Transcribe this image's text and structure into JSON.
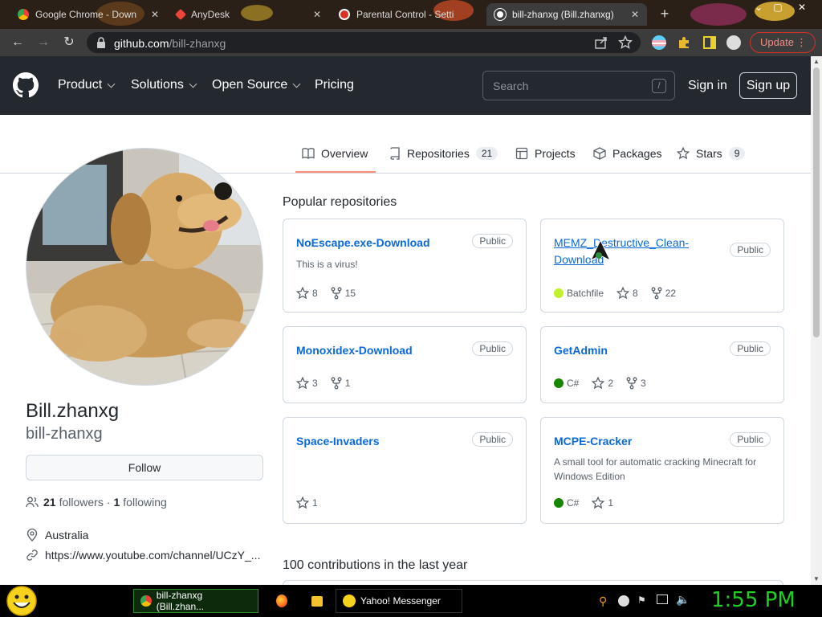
{
  "browser": {
    "tabs": [
      {
        "title": "Google Chrome - Down",
        "active": false
      },
      {
        "title": "AnyDesk",
        "active": false
      },
      {
        "title": "Parental Control - Setti",
        "active": false
      },
      {
        "title": "bill-zhanxg (Bill.zhanxg)",
        "active": true
      }
    ],
    "url_host": "github.com",
    "url_path": "/bill-zhanxg",
    "update_label": "Update"
  },
  "header": {
    "nav": [
      "Product",
      "Solutions",
      "Open Source",
      "Pricing"
    ],
    "search_placeholder": "Search",
    "search_key": "/",
    "signin": "Sign in",
    "signup": "Sign up"
  },
  "profile_tabs": [
    {
      "label": "Overview",
      "count": "",
      "active": true,
      "icon": "book-icon"
    },
    {
      "label": "Repositories",
      "count": "21",
      "active": false,
      "icon": "repo-icon"
    },
    {
      "label": "Projects",
      "count": "",
      "active": false,
      "icon": "table-icon"
    },
    {
      "label": "Packages",
      "count": "",
      "active": false,
      "icon": "package-icon"
    },
    {
      "label": "Stars",
      "count": "9",
      "active": false,
      "icon": "star-icon"
    }
  ],
  "profile": {
    "fullname": "Bill.zhanxg",
    "login": "bill-zhanxg",
    "follow_label": "Follow",
    "followers_count": "21",
    "followers_label": "followers",
    "following_count": "1",
    "following_label": "following",
    "separator": "·",
    "location": "Australia",
    "website": "https://www.youtube.com/channel/UCzY_..."
  },
  "popular": {
    "heading": "Popular repositories",
    "repos": [
      {
        "name": "NoEscape.exe-Download",
        "visibility": "Public",
        "description": "This is a virus!",
        "language": "",
        "lang_color": "",
        "stars": "8",
        "forks": "15"
      },
      {
        "name": "MEMZ_Destructive_Clean-Download",
        "visibility": "Public",
        "description": "",
        "language": "Batchfile",
        "lang_color": "#C1F12E",
        "stars": "8",
        "forks": "22"
      },
      {
        "name": "Monoxidex-Download",
        "visibility": "Public",
        "description": "",
        "language": "",
        "lang_color": "",
        "stars": "3",
        "forks": "1"
      },
      {
        "name": "GetAdmin",
        "visibility": "Public",
        "description": "",
        "language": "C#",
        "lang_color": "#178600",
        "stars": "2",
        "forks": "3"
      },
      {
        "name": "Space-Invaders",
        "visibility": "Public",
        "description": "",
        "language": "",
        "lang_color": "",
        "stars": "1",
        "forks": ""
      },
      {
        "name": "MCPE-Cracker",
        "visibility": "Public",
        "description": "A small tool for automatic cracking Minecraft for Windows Edition",
        "language": "C#",
        "lang_color": "#178600",
        "stars": "1",
        "forks": ""
      }
    ]
  },
  "contributions": {
    "heading": "100 contributions in the last year"
  },
  "taskbar": {
    "tasks": [
      "bill-zhanxg (Bill.zhan...",
      "Yahoo! Messenger"
    ],
    "clock": "1:55 PM"
  },
  "colors": {
    "github_dark": "#24292f",
    "link": "#0969da",
    "active_tab_underline": "#fd8c73",
    "clock": "#1fd11f"
  }
}
